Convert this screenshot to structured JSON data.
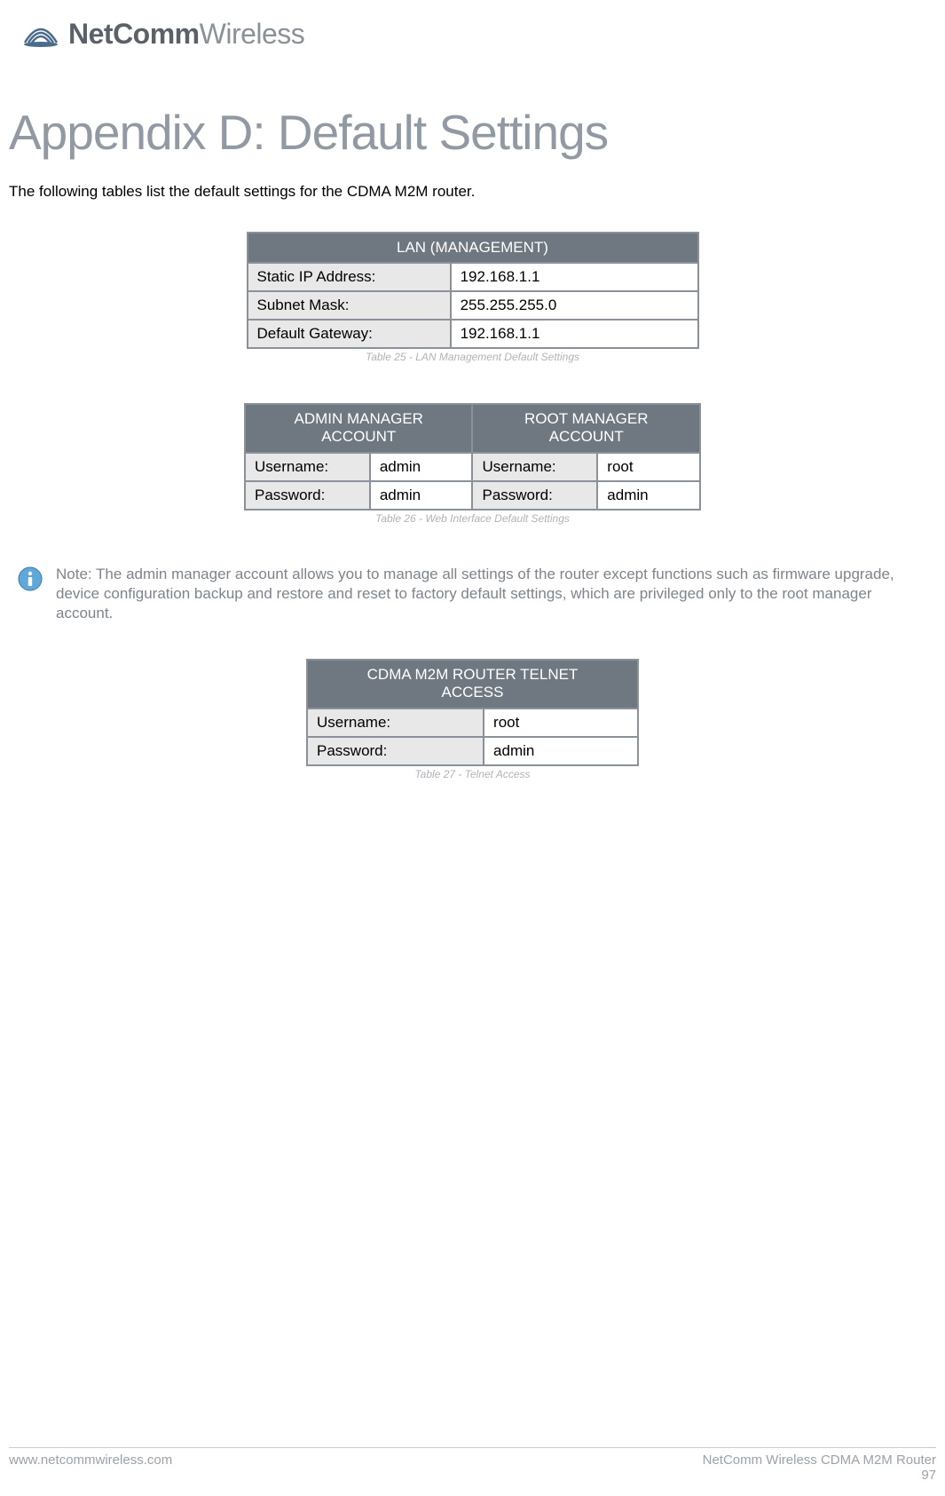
{
  "brand": {
    "bold": "NetComm",
    "light": "Wireless"
  },
  "title": "Appendix D: Default Settings",
  "intro": "The following tables list the default settings for the CDMA M2M router.",
  "lan": {
    "header": "LAN (MANAGEMENT)",
    "rows": [
      {
        "label": "Static IP Address:",
        "value": "192.168.1.1"
      },
      {
        "label": "Subnet Mask:",
        "value": "255.255.255.0"
      },
      {
        "label": "Default Gateway:",
        "value": "192.168.1.1"
      }
    ],
    "caption": "Table 25 - LAN Management Default Settings"
  },
  "accounts": {
    "headers": [
      "ADMIN MANAGER ACCOUNT",
      "ROOT MANAGER ACCOUNT"
    ],
    "rows": [
      {
        "l1": "Username:",
        "v1": "admin",
        "l2": "Username:",
        "v2": "root"
      },
      {
        "l1": "Password:",
        "v1": "admin",
        "l2": "Password:",
        "v2": "admin"
      }
    ],
    "caption": "Table 26 - Web Interface Default Settings"
  },
  "note": "Note: The admin manager account allows you to manage all settings of the router except functions such as firmware upgrade, device configuration backup and restore and reset to factory default settings, which are privileged only to the root manager account.",
  "telnet": {
    "header": "CDMA M2M ROUTER TELNET ACCESS",
    "rows": [
      {
        "label": "Username:",
        "value": "root"
      },
      {
        "label": "Password:",
        "value": "admin"
      }
    ],
    "caption": "Table 27 - Telnet Access"
  },
  "footer": {
    "left": "www.netcommwireless.com",
    "right": "NetComm Wireless CDMA M2M Router",
    "page": "97"
  }
}
